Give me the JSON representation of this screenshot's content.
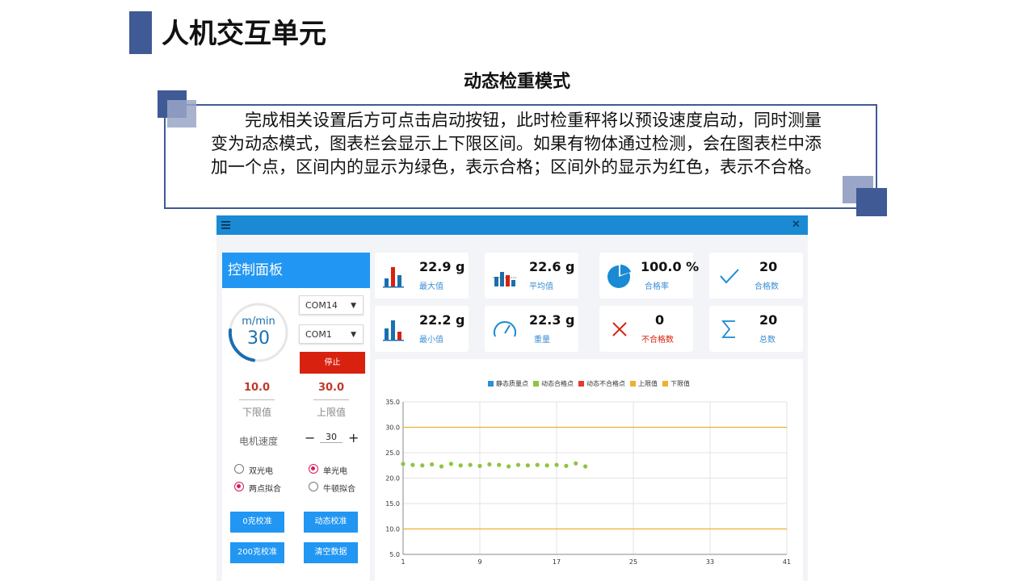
{
  "slide": {
    "title": "人机交互单元",
    "subtitle": "动态检重模式",
    "description": "完成相关设置后方可点击启动按钮，此时检重秤将以预设速度启动，同时测量变为动态模式，图表栏会显示上下限区间。如果有物体通过检测，会在图表栏中添加一个点，区间内的显示为绿色，表示合格；区间外的显示为红色，表示不合格。"
  },
  "app": {
    "menu_icon": "hamburger-icon",
    "close_icon": "close-icon",
    "close_glyph": "✕",
    "panel": {
      "title": "控制面板",
      "gauge": {
        "unit": "m/min",
        "value": "30",
        "fraction": 0.35
      },
      "com_select_1": "COM14",
      "com_select_2": "COM1",
      "stop_label": "停止",
      "lower_limit": {
        "value": "10.0",
        "label": "下限值"
      },
      "upper_limit": {
        "value": "30.0",
        "label": "上限值"
      },
      "motor_speed": {
        "label": "电机速度",
        "minus": "−",
        "plus": "+",
        "value": "30"
      },
      "radios": [
        {
          "label": "双光电",
          "checked": false
        },
        {
          "label": "单光电",
          "checked": true
        },
        {
          "label": "两点拟合",
          "checked": true
        },
        {
          "label": "牛顿拟合",
          "checked": false
        }
      ],
      "buttons": {
        "zero_cal": "0克校准",
        "dynamic_cal": "动态校准",
        "cal_200": "200克校准",
        "clear_data": "清空数据"
      }
    },
    "stats": [
      {
        "value": "22.9 g",
        "label": "最大值",
        "icon": "bar-chart-icon"
      },
      {
        "value": "22.6 g",
        "label": "平均值",
        "icon": "bar-chart-average-icon"
      },
      {
        "value": "100.0 %",
        "label": "合格率",
        "icon": "pie-chart-icon"
      },
      {
        "value": "20",
        "label": "合格数",
        "icon": "check-icon"
      },
      {
        "value": "22.2 g",
        "label": "最小值",
        "icon": "bar-chart-min-icon"
      },
      {
        "value": "22.3 g",
        "label": "重量",
        "icon": "speedometer-icon"
      },
      {
        "value": "0",
        "label": "不合格数",
        "icon": "cross-icon"
      },
      {
        "value": "20",
        "label": "总数",
        "icon": "sigma-icon"
      }
    ],
    "colors": {
      "accent": "#2196f3",
      "top_bar": "#1a8ad4",
      "stop": "#d9210f",
      "pass": "#8cc63f",
      "fail": "#e53935",
      "static": "#2d8fd5",
      "limit": "#f0b030"
    }
  },
  "chart_data": {
    "type": "scatter",
    "legend": [
      "静态质量点",
      "动态合格点",
      "动态不合格点",
      "上限值",
      "下限值"
    ],
    "legend_colors": [
      "#2d8fd5",
      "#8cc63f",
      "#e53935",
      "#f0b030",
      "#f0b030"
    ],
    "xlim": [
      1,
      41
    ],
    "ylim": [
      5.0,
      35.0
    ],
    "x_ticks": [
      "1",
      "9",
      "17",
      "25",
      "33",
      "41"
    ],
    "y_ticks": [
      "5.0",
      "10.0",
      "15.0",
      "20.0",
      "25.0",
      "30.0",
      "35.0"
    ],
    "upper_limit": 30.0,
    "lower_limit": 10.0,
    "series": [
      {
        "name": "动态合格点",
        "x": [
          1,
          2,
          3,
          4,
          5,
          6,
          7,
          8,
          9,
          10,
          11,
          12,
          13,
          14,
          15,
          16,
          17,
          18,
          19,
          20
        ],
        "y": [
          22.8,
          22.6,
          22.5,
          22.7,
          22.3,
          22.8,
          22.5,
          22.6,
          22.4,
          22.7,
          22.6,
          22.3,
          22.6,
          22.5,
          22.6,
          22.5,
          22.6,
          22.4,
          22.9,
          22.3
        ]
      }
    ],
    "grid": true
  }
}
